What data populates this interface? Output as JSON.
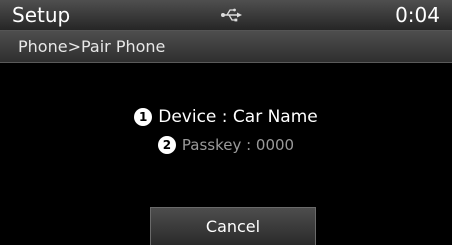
{
  "status_bar": {
    "title": "Setup",
    "icon": "usb-icon",
    "time": "0:04"
  },
  "breadcrumb": "Phone>Pair Phone",
  "info": {
    "device": {
      "number": "1",
      "text": "Device : Car Name"
    },
    "passkey": {
      "number": "2",
      "text": "Passkey : 0000"
    }
  },
  "cancel_label": "Cancel",
  "colors": {
    "background": "#000000",
    "bar": "#3a3a3a",
    "text_primary": "#ffffff",
    "text_secondary": "#9a9a9a"
  }
}
